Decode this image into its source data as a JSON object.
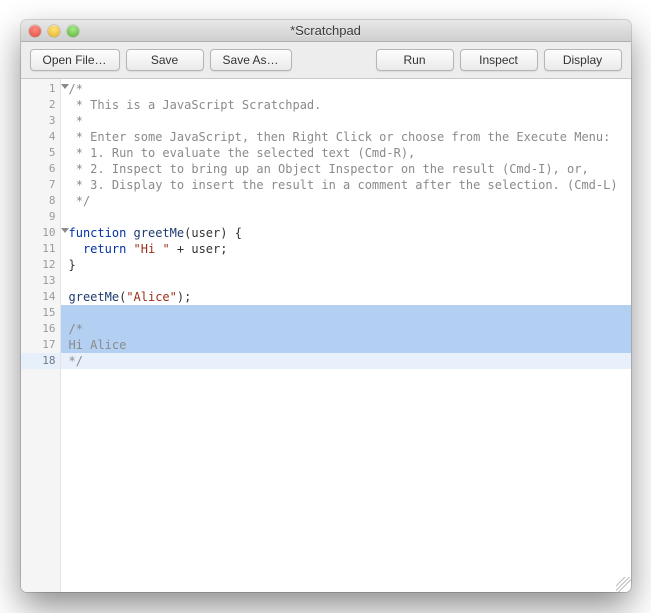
{
  "window": {
    "title": "*Scratchpad"
  },
  "toolbar": {
    "open": "Open File…",
    "save": "Save",
    "saveas": "Save As…",
    "run": "Run",
    "inspect": "Inspect",
    "display": "Display"
  },
  "editor": {
    "lines": [
      {
        "n": 1,
        "fold": true,
        "type": "comment",
        "text": "/*"
      },
      {
        "n": 2,
        "fold": false,
        "type": "comment",
        "text": " * This is a JavaScript Scratchpad."
      },
      {
        "n": 3,
        "fold": false,
        "type": "comment",
        "text": " *"
      },
      {
        "n": 4,
        "fold": false,
        "type": "comment",
        "text": " * Enter some JavaScript, then Right Click or choose from the Execute Menu:"
      },
      {
        "n": 5,
        "fold": false,
        "type": "comment",
        "text": " * 1. Run to evaluate the selected text (Cmd-R),"
      },
      {
        "n": 6,
        "fold": false,
        "type": "comment",
        "text": " * 2. Inspect to bring up an Object Inspector on the result (Cmd-I), or,"
      },
      {
        "n": 7,
        "fold": false,
        "type": "comment",
        "text": " * 3. Display to insert the result in a comment after the selection. (Cmd-L)"
      },
      {
        "n": 8,
        "fold": false,
        "type": "comment",
        "text": " */"
      },
      {
        "n": 9,
        "fold": false,
        "type": "blank",
        "text": ""
      },
      {
        "n": 10,
        "fold": true,
        "type": "code-fn",
        "kw": "function",
        "fn": "greetMe",
        "arg": "user",
        "tail": ") {"
      },
      {
        "n": 11,
        "fold": false,
        "type": "code-ret",
        "kw": "return",
        "str": "\"Hi \"",
        "tail": " + user;"
      },
      {
        "n": 12,
        "fold": false,
        "type": "plain",
        "text": "}"
      },
      {
        "n": 13,
        "fold": false,
        "type": "blank",
        "text": ""
      },
      {
        "n": 14,
        "fold": false,
        "type": "code-call",
        "fn": "greetMe",
        "str": "\"Alice\"",
        "tail": ");"
      },
      {
        "n": 15,
        "fold": false,
        "type": "blank",
        "text": "",
        "sel": true
      },
      {
        "n": 16,
        "fold": true,
        "type": "comment",
        "text": "/*",
        "sel": true
      },
      {
        "n": 17,
        "fold": false,
        "type": "comment",
        "text": "Hi Alice",
        "sel": true
      },
      {
        "n": 18,
        "fold": false,
        "type": "comment",
        "text": "*/",
        "cur": true
      }
    ]
  }
}
